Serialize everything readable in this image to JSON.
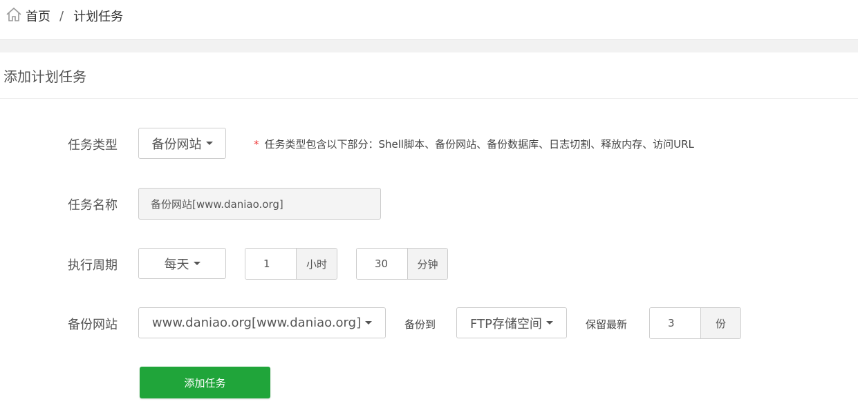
{
  "breadcrumb": {
    "home": "首页",
    "separator": "/",
    "current": "计划任务"
  },
  "panel": {
    "title": "添加计划任务"
  },
  "form": {
    "task_type": {
      "label": "任务类型",
      "value": "备份网站",
      "hint_star": "*",
      "hint": "任务类型包含以下部分：Shell脚本、备份网站、备份数据库、日志切割、释放内存、访问URL"
    },
    "task_name": {
      "label": "任务名称",
      "value": "备份网站[www.daniao.org]"
    },
    "cycle": {
      "label": "执行周期",
      "value": "每天",
      "hour_value": "1",
      "hour_unit": "小时",
      "minute_value": "30",
      "minute_unit": "分钟"
    },
    "backup_site": {
      "label": "备份网站",
      "value": "www.daniao.org[www.daniao.org]",
      "to_label": "备份到",
      "destination": "FTP存储空间",
      "keep_label": "保留最新",
      "keep_value": "3",
      "keep_unit": "份"
    },
    "submit_label": "添加任务"
  },
  "colors": {
    "accent": "#20a53a",
    "required": "#ee3333"
  }
}
